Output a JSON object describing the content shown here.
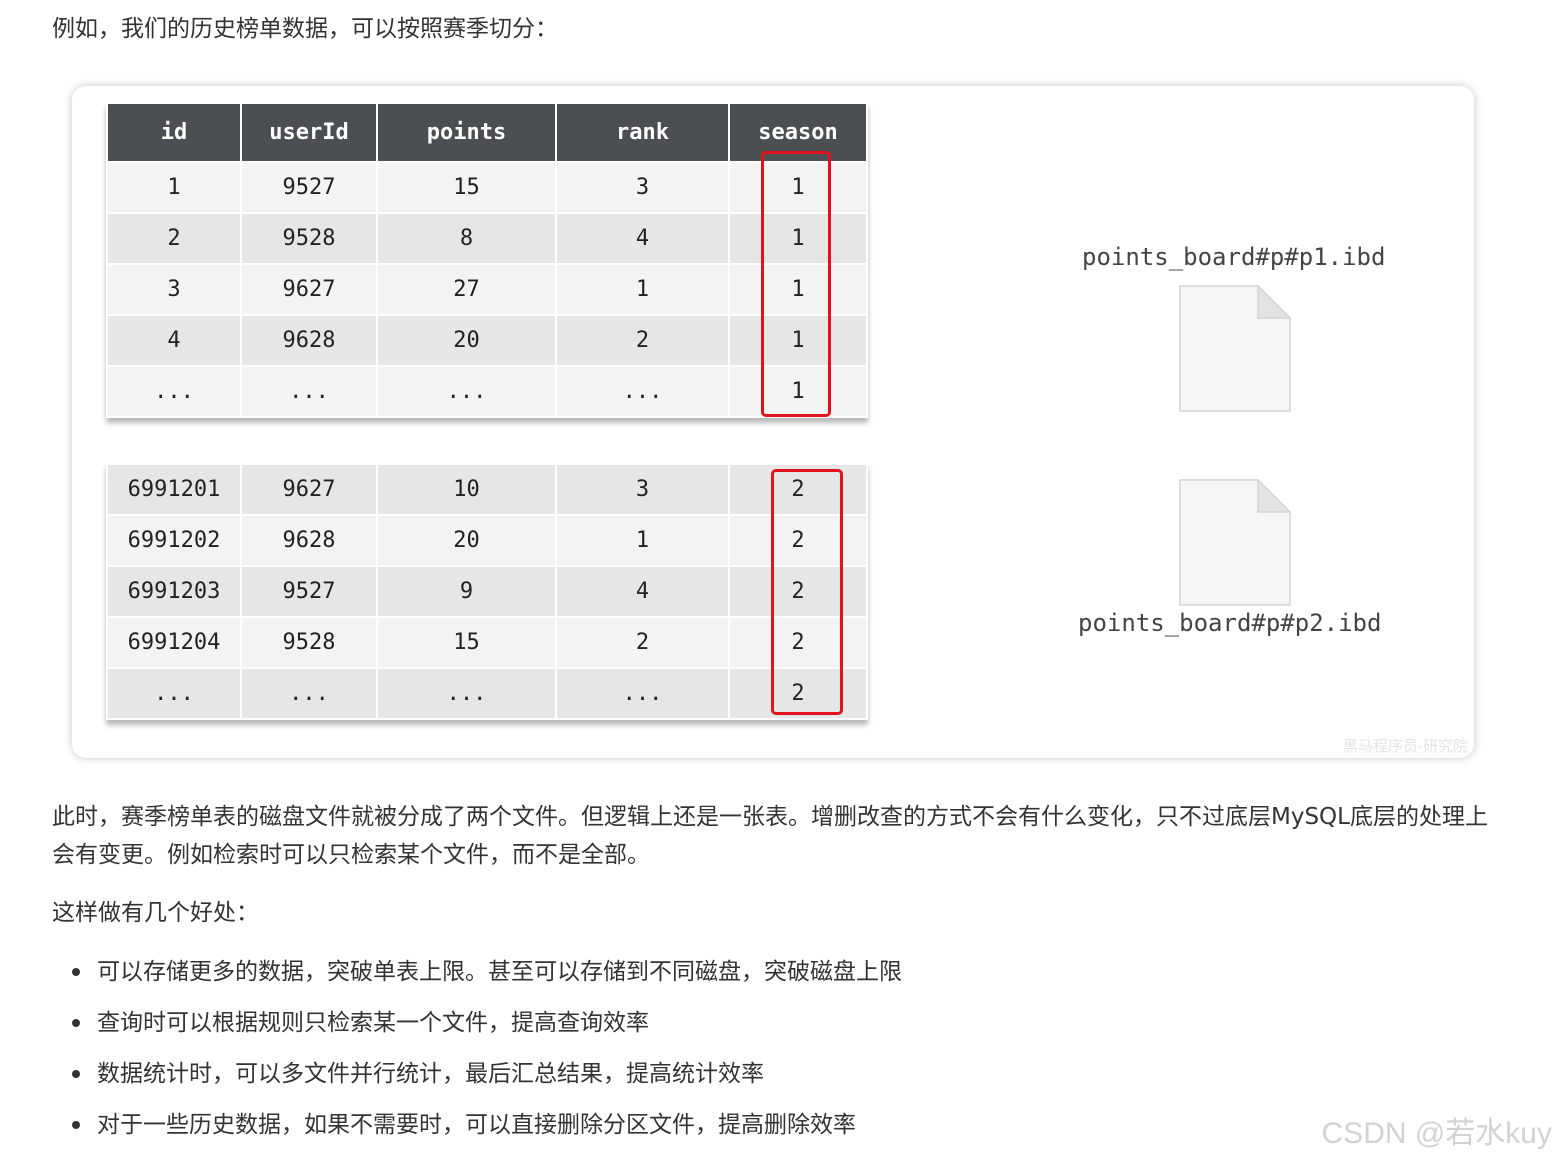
{
  "intro": "例如，我们的历史榜单数据，可以按照赛季切分：",
  "table": {
    "headers": [
      "id",
      "userId",
      "points",
      "rank",
      "season"
    ],
    "part1": [
      [
        "1",
        "9527",
        "15",
        "3",
        "1"
      ],
      [
        "2",
        "9528",
        "8",
        "4",
        "1"
      ],
      [
        "3",
        "9627",
        "27",
        "1",
        "1"
      ],
      [
        "4",
        "9628",
        "20",
        "2",
        "1"
      ],
      [
        "...",
        "...",
        "...",
        "...",
        "1"
      ]
    ],
    "part2": [
      [
        "6991201",
        "9627",
        "10",
        "3",
        "2"
      ],
      [
        "6991202",
        "9628",
        "20",
        "1",
        "2"
      ],
      [
        "6991203",
        "9527",
        "9",
        "4",
        "2"
      ],
      [
        "6991204",
        "9528",
        "15",
        "2",
        "2"
      ],
      [
        "...",
        "...",
        "...",
        "...",
        "2"
      ]
    ]
  },
  "files": {
    "file1": "points_board#p#p1.ibd",
    "file2": "points_board#p#p2.ibd"
  },
  "figure_watermark": "黑马程序员-研究院",
  "para2": "此时，赛季榜单表的磁盘文件就被分成了两个文件。但逻辑上还是一张表。增删改查的方式不会有什么变化，只不过底层MySQL底层的处理上会有变更。例如检索时可以只检索某个文件，而不是全部。",
  "para3": "这样做有几个好处：",
  "bullets": [
    "可以存储更多的数据，突破单表上限。甚至可以存储到不同磁盘，突破磁盘上限",
    "查询时可以根据规则只检索某一个文件，提高查询效率",
    "数据统计时，可以多文件并行统计，最后汇总结果，提高统计效率",
    "对于一些历史数据，如果不需要时，可以直接删除分区文件，提高删除效率"
  ],
  "watermark": "CSDN @若水kuy",
  "colors": {
    "header_bg": "#4b4f51",
    "highlight": "#e0141e",
    "row_light": "#f3f3f3",
    "row_dark": "#e6e6e6"
  }
}
